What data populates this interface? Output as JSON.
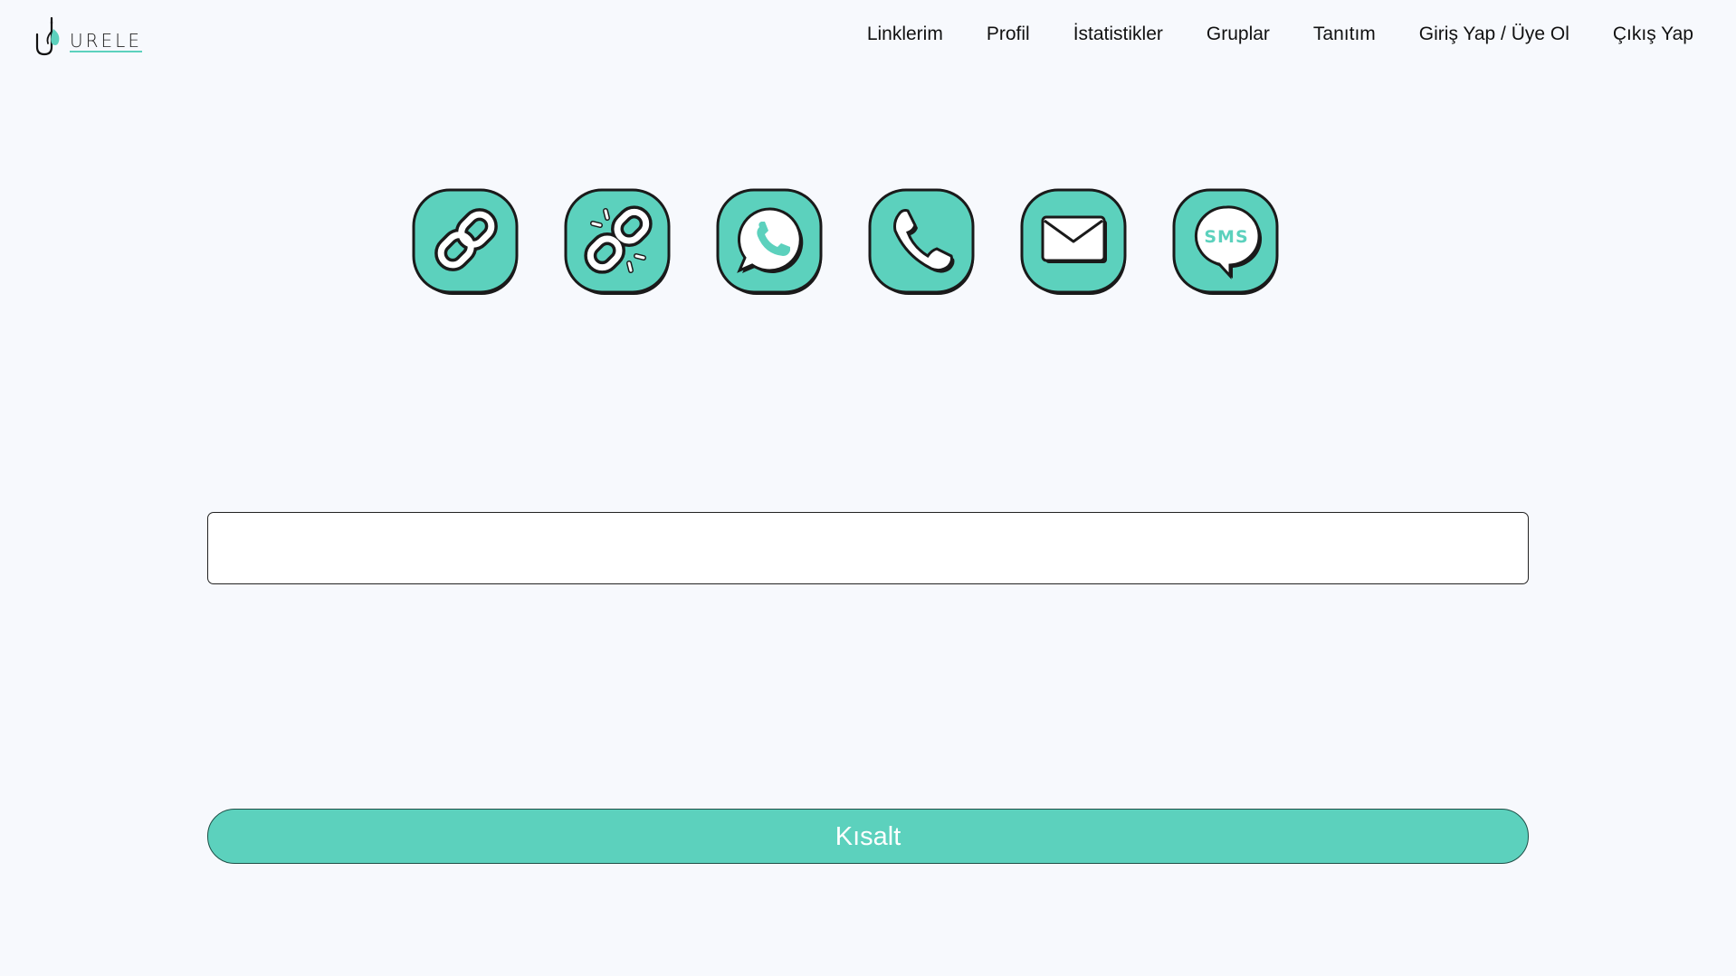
{
  "brand": {
    "logo_text": "URELE",
    "accent_color": "#5cd1bd"
  },
  "nav": {
    "items": [
      {
        "label": "Linklerim"
      },
      {
        "label": "Profil"
      },
      {
        "label": "İstatistikler"
      },
      {
        "label": "Gruplar"
      },
      {
        "label": "Tanıtım"
      },
      {
        "label": "Giriş Yap / Üye Ol"
      },
      {
        "label": "Çıkış Yap"
      }
    ]
  },
  "link_types": [
    {
      "icon": "link-icon"
    },
    {
      "icon": "broken-link-icon"
    },
    {
      "icon": "whatsapp-icon"
    },
    {
      "icon": "phone-icon"
    },
    {
      "icon": "email-icon"
    },
    {
      "icon": "sms-icon",
      "text": "SMS"
    }
  ],
  "url_input": {
    "value": "",
    "placeholder": ""
  },
  "shorten_button": {
    "label": "Kısalt"
  }
}
